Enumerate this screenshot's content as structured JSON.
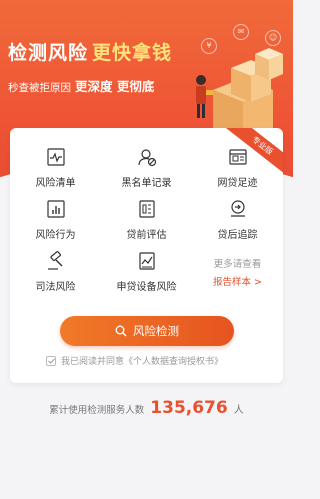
{
  "hero": {
    "title_a": "检测风险",
    "title_b": "更快拿钱",
    "subtitle_a": "秒查被拒原因",
    "subtitle_b": "更深度 更彻底",
    "badge": "专业版"
  },
  "services": [
    {
      "label": "风险清单",
      "icon": "heart-monitor-icon"
    },
    {
      "label": "黑名单记录",
      "icon": "user-block-icon"
    },
    {
      "label": "网贷足迹",
      "icon": "window-icon"
    },
    {
      "label": "风险行为",
      "icon": "bar-chart-icon"
    },
    {
      "label": "贷前评估",
      "icon": "document-icon"
    },
    {
      "label": "贷后追踪",
      "icon": "refresh-arrow-icon"
    },
    {
      "label": "司法风险",
      "icon": "gavel-icon"
    },
    {
      "label": "申贷设备风险",
      "icon": "device-chart-icon"
    }
  ],
  "more": {
    "line1": "更多请查看",
    "line2": "报告样本 >"
  },
  "action": {
    "button_label": "风险检测",
    "icon": "search-icon"
  },
  "agreement": {
    "text": "我已阅读并同意《个人数据查询授权书》"
  },
  "stats": {
    "prefix": "累计使用检测服务人数",
    "count": "135,676",
    "unit": "人"
  },
  "colors": {
    "accent": "#e9502e",
    "hero": "#ee5535",
    "button": "#f07a28"
  }
}
